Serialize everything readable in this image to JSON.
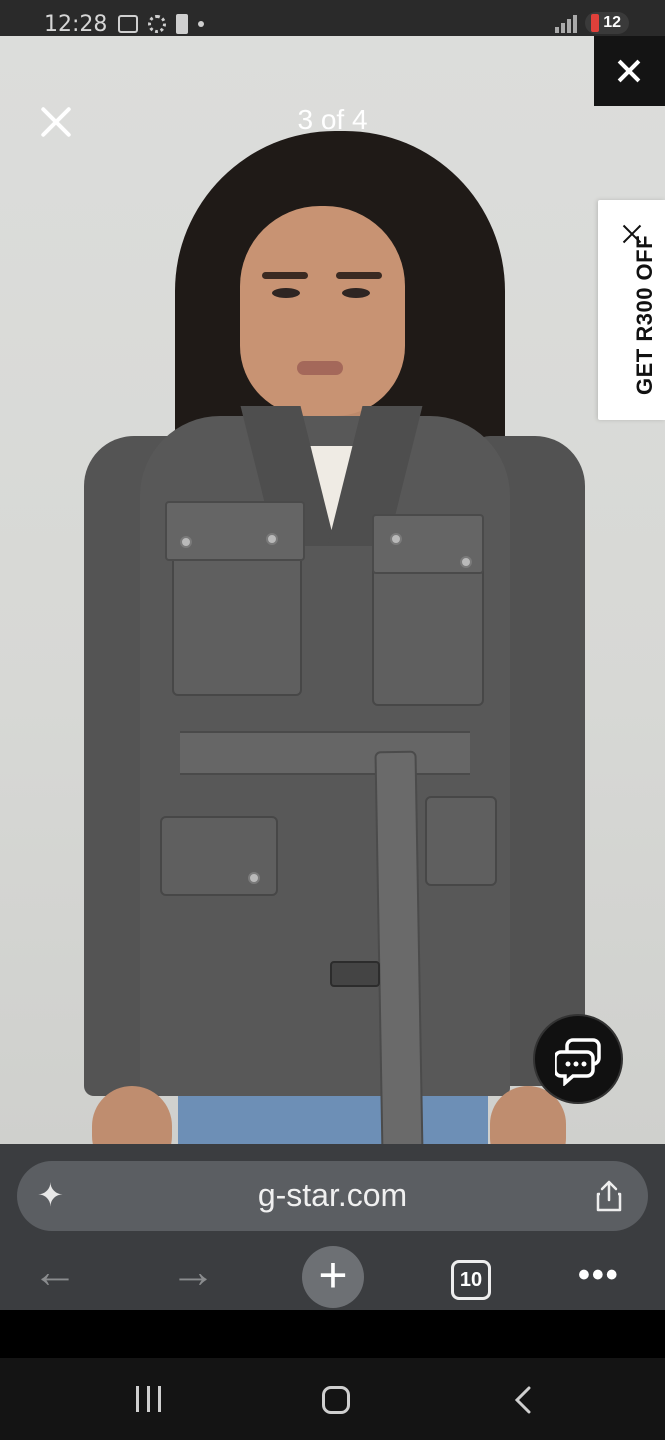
{
  "status_bar": {
    "time": "12:28",
    "battery_level": "12"
  },
  "gallery": {
    "counter": "3 of 4",
    "image_description_icon": "photo-of-model-in-grey-belted-denim-jacket"
  },
  "promo": {
    "label": "GET R300 OFF"
  },
  "browser": {
    "url": "g-star.com",
    "tab_count": "10"
  },
  "colors": {
    "promo_bg": "#ffffff",
    "dark_close_bg": "#141414",
    "browser_bar_bg": "#3b3d40",
    "url_pill_bg": "#5b5e62"
  },
  "icons": {
    "sparkle": "sparkle-icon",
    "share": "share-icon",
    "back": "arrow-left-icon",
    "forward": "arrow-right-icon",
    "new_tab": "plus-icon",
    "tabs": "tabs-icon",
    "menu": "more-horizontal-icon",
    "chat": "chat-bubbles-icon"
  }
}
